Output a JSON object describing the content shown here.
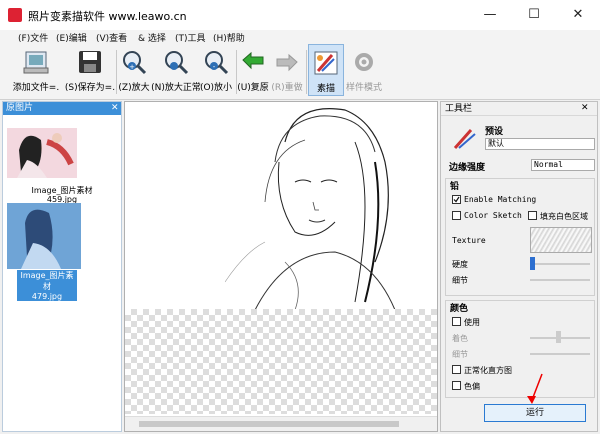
{
  "window": {
    "title": "照片变素描软件 www.leawo.cn",
    "minimize": "—",
    "maximize": "☐",
    "close": "✕"
  },
  "menu": {
    "items": [
      "(F)文件",
      "(E)编辑",
      "(V)查看",
      "& 选择",
      "(T)工具",
      "(H)帮助"
    ]
  },
  "toolbar": {
    "add_file": "添加文件=.",
    "save_as": "(S)保存为=.",
    "zoom_in": "(Z)放大",
    "zoom_normal": "(N)放大正常",
    "zoom_out": "(O)放小",
    "restore": "(U)复原",
    "redo": "(R)重做",
    "sketch": "素描",
    "style_mode": "样件模式",
    "icons": [
      "add-file-icon",
      "save-icon",
      "zoom-in-icon",
      "zoom-normal-icon",
      "zoom-out-icon",
      "undo-icon",
      "redo-icon",
      "sketch-icon",
      "gear-icon"
    ]
  },
  "left_panel": {
    "title": "原图片",
    "close": "✕",
    "thumbnails": [
      {
        "caption_line1": "Image_图片素材",
        "caption_line2": "459.jpg"
      },
      {
        "caption_line1": "Image_图片素材",
        "caption_line2": "479.jpg"
      }
    ]
  },
  "right_panel": {
    "title": "工具栏",
    "pin": "⊡",
    "close": "✕",
    "preset_label": "预设",
    "preset_value": "默认",
    "edge_strength_label": "边缘强度",
    "edge_strength_value": "Normal",
    "pencil_section": "铅",
    "enable_matching": "Enable Matching",
    "color_sketch": "Color Sketch",
    "fill_white": "填充白色区域",
    "texture_label": "Texture",
    "hardness_label": "硬度",
    "detail_label": "细节",
    "color_section": "颜色",
    "use_label": "使用",
    "saturation_label": "着色",
    "detail2_label": "细节",
    "normalize_label": "正常化直方图",
    "color_shift_label": "色偏",
    "run_button": "运行"
  },
  "colors": {
    "accent": "#3c8fd8",
    "selection": "#3c8fd8",
    "sketch_active": "#cfe3f7"
  }
}
